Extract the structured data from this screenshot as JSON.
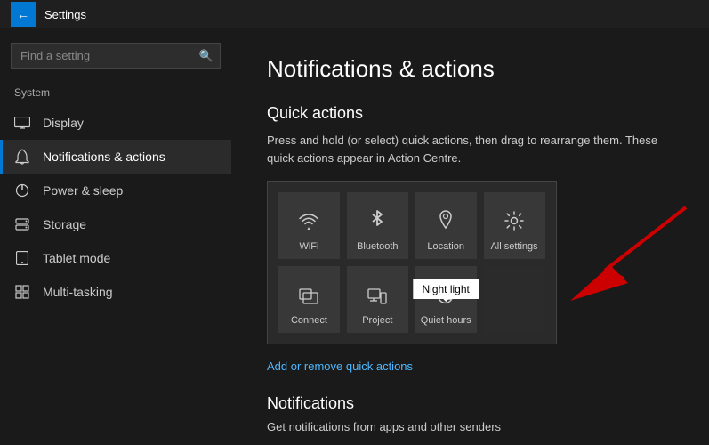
{
  "titleBar": {
    "backLabel": "←",
    "title": "Settings"
  },
  "sidebar": {
    "searchPlaceholder": "Find a setting",
    "category": "System",
    "items": [
      {
        "id": "display",
        "label": "Display",
        "icon": "🖥"
      },
      {
        "id": "notifications",
        "label": "Notifications & actions",
        "icon": "🔔",
        "active": true
      },
      {
        "id": "power",
        "label": "Power & sleep",
        "icon": "⏻"
      },
      {
        "id": "storage",
        "label": "Storage",
        "icon": "📦"
      },
      {
        "id": "tablet",
        "label": "Tablet mode",
        "icon": "⊞"
      },
      {
        "id": "multitasking",
        "label": "Multi-tasking",
        "icon": "⧉"
      }
    ]
  },
  "content": {
    "pageTitle": "Notifications & actions",
    "quickActionsSection": {
      "title": "Quick actions",
      "description": "Press and hold (or select) quick actions, then drag to rearrange them. These quick actions appear in Action Centre.",
      "tiles": [
        {
          "id": "wifi",
          "label": "WiFi",
          "icon": "wifi"
        },
        {
          "id": "bluetooth",
          "label": "Bluetooth",
          "icon": "bluetooth"
        },
        {
          "id": "location",
          "label": "Location",
          "icon": "location"
        },
        {
          "id": "allsettings",
          "label": "All settings",
          "icon": "gear"
        },
        {
          "id": "connect",
          "label": "Connect",
          "icon": "connect"
        },
        {
          "id": "project",
          "label": "Project",
          "icon": "project"
        },
        {
          "id": "nightlight",
          "label": "Quiet hours",
          "icon": "moon",
          "tooltip": "Night light"
        }
      ],
      "addLink": "Add or remove quick actions"
    },
    "notificationsSection": {
      "title": "Notifications",
      "description": "Get notifications from apps and other senders"
    }
  }
}
